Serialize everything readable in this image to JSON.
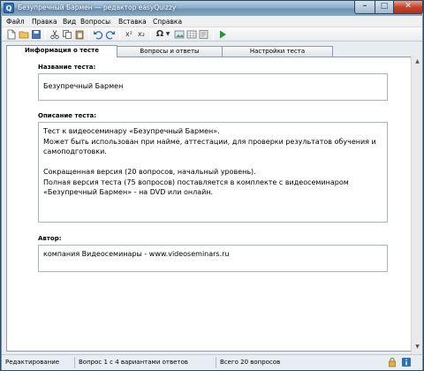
{
  "window": {
    "title": "Безупречный Бармен — редактор easyQuizzy",
    "app_icon_letter": "Q"
  },
  "menu": [
    "Файл",
    "Правка",
    "Вид",
    "Вопросы",
    "Вставка",
    "Справка"
  ],
  "toolbar": {
    "icons": [
      "new-file-icon",
      "open-folder-icon",
      "save-icon",
      "cut-icon",
      "copy-icon",
      "paste-icon",
      "undo-icon",
      "redo-icon",
      "superscript-icon",
      "subscript-icon",
      "special-char-icon",
      "image-icon",
      "table-icon",
      "play-icon"
    ],
    "superscript": "x²",
    "subscript": "x₂",
    "special_char": "Ω"
  },
  "tabs": [
    "Информация о тесте",
    "Вопросы и ответы",
    "Настройки теста"
  ],
  "fields": {
    "name_label": "Название теста:",
    "name_value": "Безупречный Бармен",
    "desc_label": "Описание теста:",
    "desc_value": "Тест к видеосеминару «Безупречный Бармен».\nМожет быть использован при найме, аттестации, для проверки результатов обучения и самоподготовки.\n\nСокращенная версия (20 вопросов, начальный уровень).\nПолная версия теста (75 вопросов) поставляется в комплекте с видеосеминаром «Безупречный Бармен» - на DVD или онлайн.",
    "author_label": "Автор:",
    "author_value": "компания Видеосеминары - www.videoseminars.ru"
  },
  "status": {
    "mode": "Редактирование",
    "question": "Вопрос 1 с 4 вариантами ответов",
    "total": "Всего 20 вопросов"
  },
  "colors": {
    "accent": "#2d6fb5",
    "play_green": "#1e9b2e"
  }
}
